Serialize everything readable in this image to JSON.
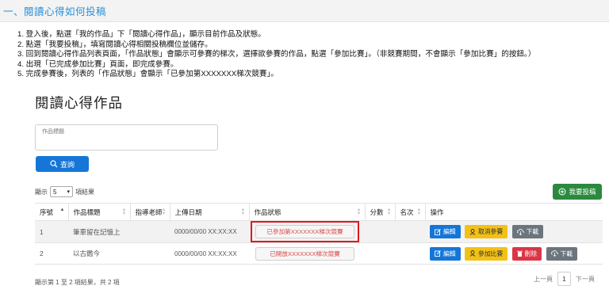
{
  "section": {
    "title": "一、閱讀心得如何投稿"
  },
  "steps": [
    "1. 登入後，點選「我的作品」下「閱讀心得作品」，顯示目前作品及狀態。",
    "2. 點選「我要投稿」，填寫閱讀心得相關投稿欄位並儲存。",
    "3. 回到閱讀心得作品列表頁面，「作品狀態」會顯示可參賽的梯次，選擇欲參賽的作品，點選「參加比賽」。（非競賽期間，不會顯示「參加比賽」的按鈕。）",
    "4. 出現「已完成參加比賽」頁面，即完成參賽。",
    "5. 完成參賽後，列表的「作品狀態」會顯示「已參加第XXXXXXX梯次競賽」。"
  ],
  "card": {
    "title": "閱讀心得作品",
    "search_label": "作品標題",
    "search_value": "",
    "query_button": "查詢",
    "submit_button": "我要投稿",
    "length_prefix": "顯示",
    "length_value": "5",
    "length_suffix": "項結果"
  },
  "table": {
    "headers": [
      "序號",
      "作品標題",
      "指導老師",
      "上傳日期",
      "作品狀態",
      "分數",
      "名次",
      "操作"
    ],
    "rows": [
      {
        "no": "1",
        "title": "筆車留在記憶上",
        "teacher": "",
        "date": "0000/00/00 XX:XX:XX",
        "status": "已參加第XXXXXXX梯次競賽",
        "score": "",
        "rank": "",
        "actions": [
          "編輯",
          "取消參賽",
          "下載"
        ]
      },
      {
        "no": "2",
        "title": "以古鑑今",
        "teacher": "",
        "date": "0000/00/00 XX:XX:XX",
        "status": "已開放XXXXXXX梯次競賽",
        "score": "",
        "rank": "",
        "actions": [
          "編輯",
          "參加比賽",
          "刪除",
          "下載"
        ]
      }
    ]
  },
  "footer": {
    "info": "顯示第 1 至 2 項結果，共 2 項",
    "prev": "上一頁",
    "page": "1",
    "next": "下一頁"
  },
  "icons": {
    "query": "search-icon",
    "submit": "plus-circle-icon",
    "edit": "edit-icon",
    "cancel": "person-icon",
    "download": "cloud-download-icon",
    "delete": "trash-icon"
  },
  "colors": {
    "link": "#2a8fd9",
    "primary": "#1576d8",
    "success": "#2b8a3e",
    "warning": "#f3c116",
    "danger": "#dc3545",
    "secondary": "#6c757d",
    "highlight": "#e0191b"
  }
}
